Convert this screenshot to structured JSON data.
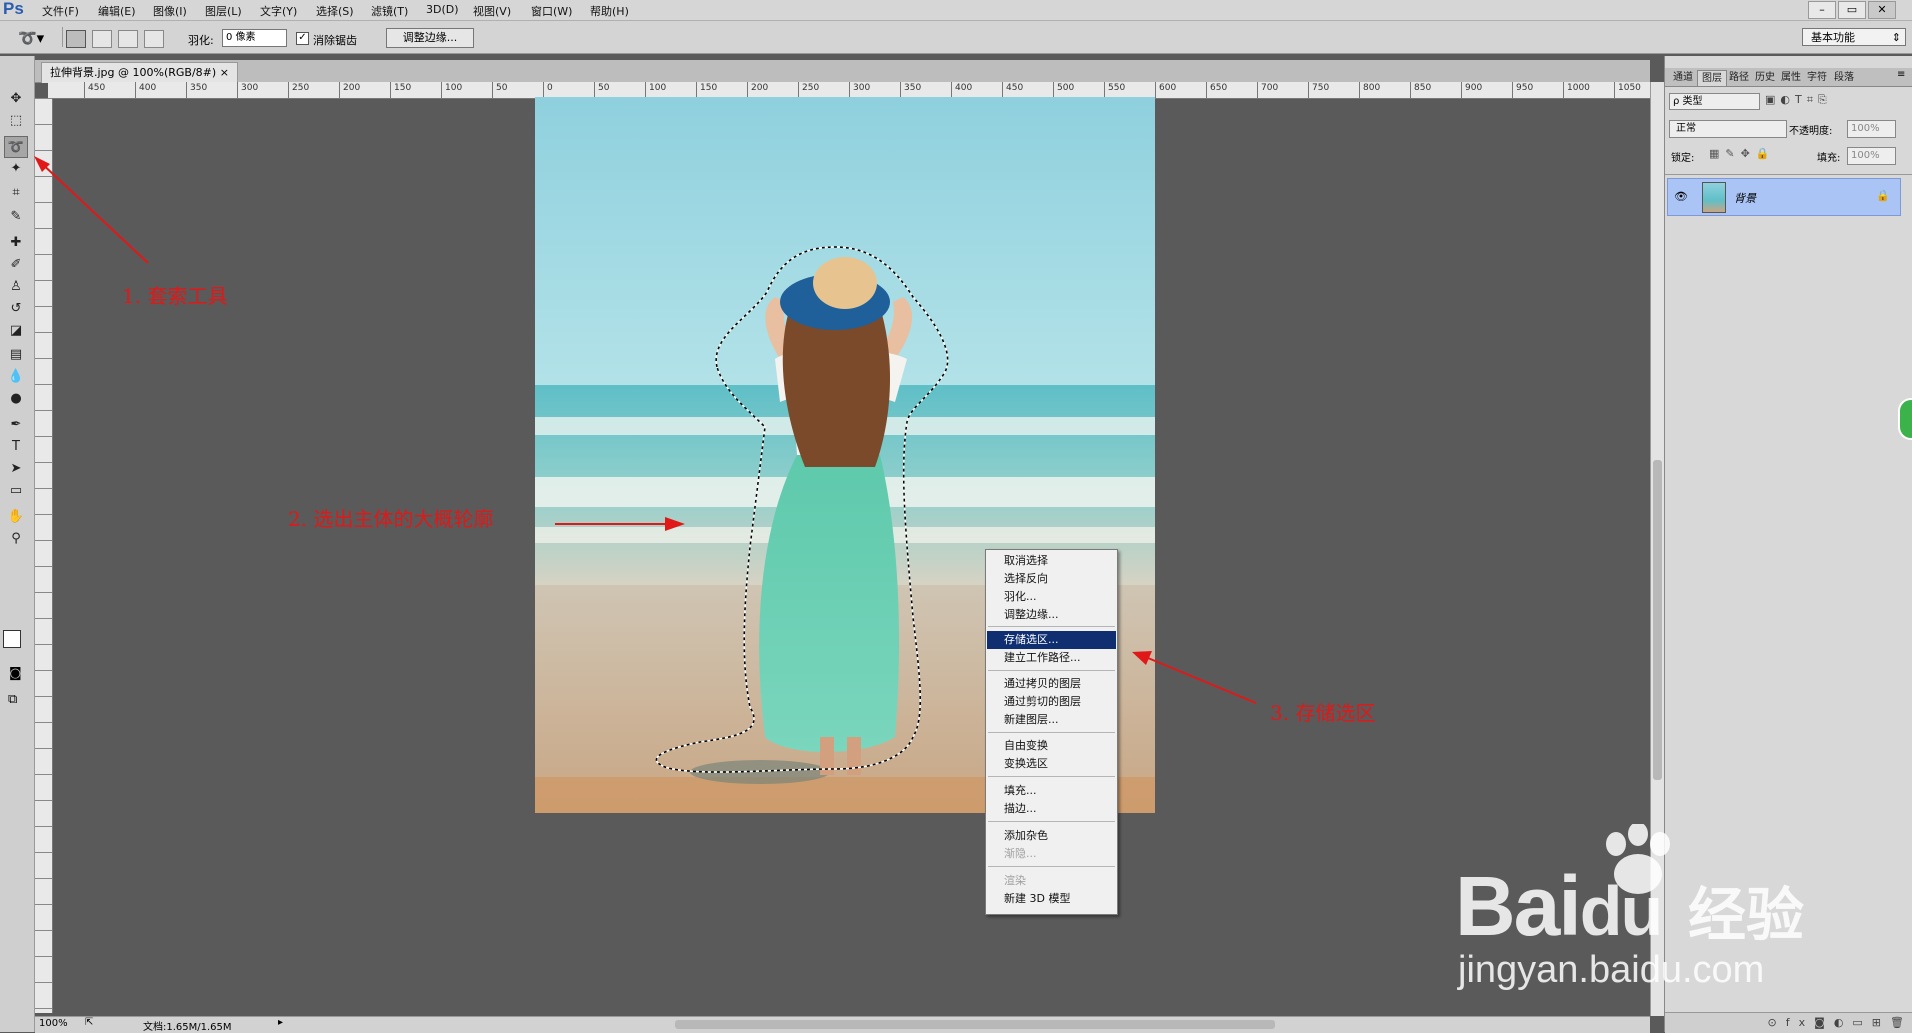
{
  "app": {
    "logo": "Ps"
  },
  "menu": [
    "文件(F)",
    "编辑(E)",
    "图像(I)",
    "图层(L)",
    "文字(Y)",
    "选择(S)",
    "滤镜(T)",
    "3D(D)",
    "视图(V)",
    "窗口(W)",
    "帮助(H)"
  ],
  "window_controls": [
    "–",
    "▭",
    "✕"
  ],
  "options": {
    "feather_label": "羽化:",
    "feather_value": "0 像素",
    "antialias_label": "消除锯齿",
    "refine_edge_button": "调整边缘...",
    "workspace": "基本功能"
  },
  "document": {
    "tab_title": "拉伸背景.jpg @ 100%(RGB/8#)",
    "zoom": "100%",
    "doc_info": "文档:1.65M/1.65M"
  },
  "ruler_top_labels": [
    "450",
    "400",
    "350",
    "300",
    "250",
    "200",
    "150",
    "100",
    "50",
    "0",
    "50",
    "100",
    "150",
    "200",
    "250",
    "300",
    "350",
    "400",
    "450",
    "500",
    "550",
    "600",
    "650",
    "700",
    "750",
    "800",
    "850",
    "900",
    "950",
    "1000",
    "1050"
  ],
  "tools": [
    {
      "icon": "move-tool-icon",
      "glyph": "✥"
    },
    {
      "icon": "marquee-tool-icon",
      "glyph": "⬚"
    },
    {
      "icon": "lasso-tool-icon",
      "glyph": "➰"
    },
    {
      "icon": "quick-select-icon",
      "glyph": "✦"
    },
    {
      "icon": "crop-tool-icon",
      "glyph": "⌗"
    },
    {
      "icon": "eyedropper-icon",
      "glyph": "✎"
    },
    {
      "icon": "healing-brush-icon",
      "glyph": "✚"
    },
    {
      "icon": "brush-tool-icon",
      "glyph": "✐"
    },
    {
      "icon": "clone-stamp-icon",
      "glyph": "♙"
    },
    {
      "icon": "history-brush-icon",
      "glyph": "↺"
    },
    {
      "icon": "eraser-icon",
      "glyph": "◪"
    },
    {
      "icon": "gradient-icon",
      "glyph": "▤"
    },
    {
      "icon": "blur-tool-icon",
      "glyph": "💧"
    },
    {
      "icon": "dodge-tool-icon",
      "glyph": "●"
    },
    {
      "icon": "pen-tool-icon",
      "glyph": "✒"
    },
    {
      "icon": "type-tool-icon",
      "glyph": "T"
    },
    {
      "icon": "path-select-icon",
      "glyph": "➤"
    },
    {
      "icon": "rectangle-tool-icon",
      "glyph": "▭"
    },
    {
      "icon": "hand-tool-icon",
      "glyph": "✋"
    },
    {
      "icon": "zoom-tool-icon",
      "glyph": "⚲"
    }
  ],
  "panel": {
    "tabs": [
      "通道",
      "图层",
      "路径",
      "历史",
      "属性",
      "字符",
      "段落"
    ],
    "kind_filter": "ρ 类型",
    "blend_mode": "正常",
    "opacity_label": "不透明度:",
    "opacity_value": "100%",
    "lock_label": "锁定:",
    "fill_label": "填充:",
    "fill_value": "100%",
    "layer_name": "背景"
  },
  "context_menu": {
    "items": [
      "取消选择",
      "选择反向",
      "羽化...",
      "调整边缘...",
      "存储选区...",
      "建立工作路径...",
      "通过拷贝的图层",
      "通过剪切的图层",
      "新建图层...",
      "自由变换",
      "变换选区",
      "填充...",
      "描边...",
      "添加杂色",
      "渐隐...",
      "渲染",
      "新建 3D 模型"
    ],
    "highlighted": "存储选区..."
  },
  "annotations": {
    "step1": "1. 套索工具",
    "step2": "2. 选出主体的大概轮廓",
    "step3": "3. 存储选区"
  },
  "watermark": {
    "brand": "Bai",
    "brand2": "du",
    "cn": "经验",
    "url": "jingyan.baidu.com"
  },
  "colors": {
    "annotation": "#e01818",
    "menu_highlight": "#102f70",
    "layer_selected": "#a9c4f5"
  }
}
